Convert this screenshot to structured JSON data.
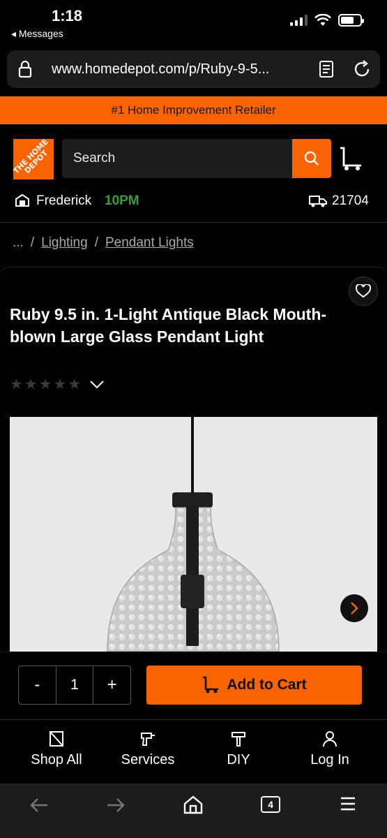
{
  "status": {
    "time": "1:18",
    "back_label": "Messages"
  },
  "browser": {
    "url": "www.homedepot.com/p/Ruby-9-5...",
    "tab_count": "4"
  },
  "promo": {
    "text": "#1 Home Improvement Retailer"
  },
  "header": {
    "logo_text": "THE HOME DEPOT",
    "search_placeholder": "Search",
    "store_name": "Frederick",
    "store_hours": "10PM",
    "zip": "21704"
  },
  "breadcrumb": {
    "ellipsis": "...",
    "sep": "/",
    "items": [
      "Lighting",
      "Pendant Lights"
    ]
  },
  "product": {
    "title": "Ruby 9.5 in. 1-Light Antique Black Mouth-blown Large Glass Pendant Light",
    "rating_stars": 0,
    "star_glyph": "★"
  },
  "cart": {
    "decrement": "-",
    "quantity": "1",
    "increment": "+",
    "add_label": "Add to Cart"
  },
  "bottom_nav": {
    "items": [
      "Shop All",
      "Services",
      "DIY",
      "Log In"
    ]
  },
  "colors": {
    "brand_orange": "#f96302",
    "open_green": "#3d9d3d"
  }
}
